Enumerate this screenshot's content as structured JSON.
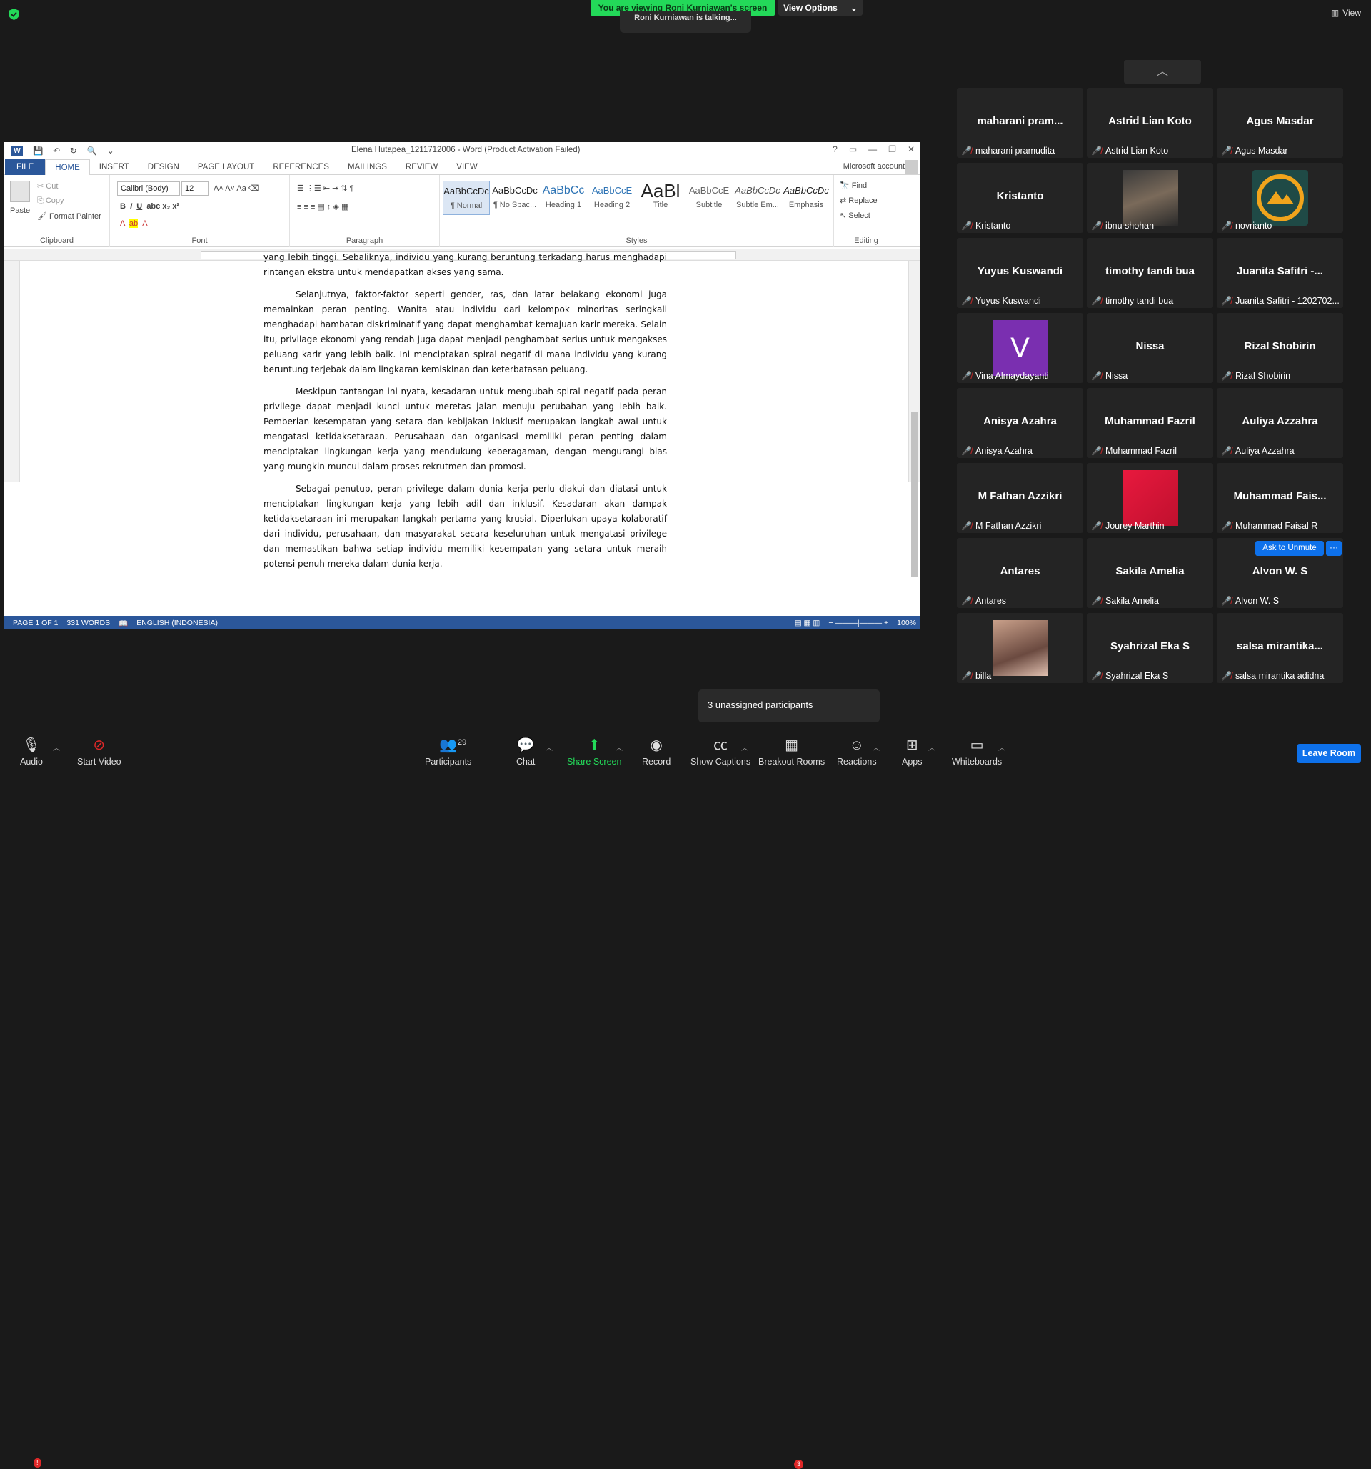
{
  "zoom": {
    "banner": "You are viewing Roni Kurniawan's screen",
    "view_options": "View Options",
    "talking": "Roni Kurniawan is talking...",
    "view_label": "View"
  },
  "word": {
    "title": "Elena Hutapea_1211712006 - Word (Product Activation Failed)",
    "tabs": [
      "FILE",
      "HOME",
      "INSERT",
      "DESIGN",
      "PAGE LAYOUT",
      "REFERENCES",
      "MAILINGS",
      "REVIEW",
      "VIEW"
    ],
    "account": "Microsoft account",
    "clipboard": {
      "paste": "Paste",
      "cut": "Cut",
      "copy": "Copy",
      "format_painter": "Format Painter",
      "label": "Clipboard"
    },
    "font": {
      "name": "Calibri (Body)",
      "size": "12",
      "label": "Font"
    },
    "paragraph_label": "Paragraph",
    "styles": [
      {
        "preview": "AaBbCcDc",
        "name": "¶ Normal"
      },
      {
        "preview": "AaBbCcDc",
        "name": "¶ No Spac..."
      },
      {
        "preview": "AaBbCc",
        "name": "Heading 1"
      },
      {
        "preview": "AaBbCcE",
        "name": "Heading 2"
      },
      {
        "preview": "AaBl",
        "name": "Title"
      },
      {
        "preview": "AaBbCcE",
        "name": "Subtitle"
      },
      {
        "preview": "AaBbCcDc",
        "name": "Subtle Em..."
      },
      {
        "preview": "AaBbCcDc",
        "name": "Emphasis"
      }
    ],
    "styles_label": "Styles",
    "editing": {
      "find": "Find",
      "replace": "Replace",
      "select": "Select",
      "label": "Editing"
    },
    "paragraphs": [
      "yang lebih tinggi. Sebaliknya, individu yang kurang beruntung terkadang harus menghadapi rintangan ekstra untuk mendapatkan akses yang sama.",
      "Selanjutnya, faktor-faktor seperti gender, ras, dan latar belakang ekonomi juga memainkan peran penting. Wanita atau individu dari kelompok minoritas seringkali menghadapi hambatan diskriminatif yang dapat menghambat kemajuan karir mereka. Selain itu, privilage ekonomi yang rendah juga dapat menjadi penghambat serius untuk mengakses peluang karir yang lebih baik. Ini menciptakan spiral negatif di mana individu yang kurang beruntung terjebak dalam lingkaran kemiskinan dan keterbatasan peluang.",
      "Meskipun tantangan ini nyata, kesadaran untuk mengubah spiral negatif pada peran privilege dapat menjadi kunci untuk meretas jalan menuju perubahan yang lebih baik. Pemberian kesempatan yang setara dan kebijakan inklusif merupakan langkah awal untuk mengatasi ketidaksetaraan. Perusahaan dan organisasi memiliki peran penting dalam menciptakan lingkungan kerja yang mendukung keberagaman, dengan mengurangi bias yang mungkin muncul dalam proses rekrutmen dan promosi.",
      "Sebagai penutup, peran privilege dalam dunia kerja perlu diakui dan diatasi untuk menciptakan lingkungan kerja yang lebih adil dan inklusif. Kesadaran akan dampak ketidaksetaraan ini merupakan langkah pertama yang krusial. Diperlukan upaya kolaboratif dari individu, perusahaan, dan masyarakat secara keseluruhan untuk mengatasi privilege dan memastikan bahwa setiap individu memiliki kesempatan yang setara untuk meraih potensi penuh mereka dalam dunia kerja."
    ],
    "status": {
      "page": "PAGE 1 OF 1",
      "words": "331 WORDS",
      "lang": "ENGLISH (INDONESIA)",
      "zoom": "100%"
    }
  },
  "participants": [
    {
      "big": "maharani  pram...",
      "small": "maharani pramudita",
      "video": "none"
    },
    {
      "big": "Astrid Lian Koto",
      "small": "Astrid Lian Koto",
      "video": "none"
    },
    {
      "big": "Agus Masdar",
      "small": "Agus Masdar",
      "video": "none"
    },
    {
      "big": "Kristanto",
      "small": "Kristanto",
      "video": "none"
    },
    {
      "big": "",
      "small": "ibnu shohan",
      "video": "photo"
    },
    {
      "big": "",
      "small": "novrianto",
      "video": "logo"
    },
    {
      "big": "Yuyus Kuswandi",
      "small": "Yuyus Kuswandi",
      "video": "none"
    },
    {
      "big": "timothy tandi bua",
      "small": "timothy tandi bua",
      "video": "none"
    },
    {
      "big": "Juanita Safitri -...",
      "small": "Juanita Safitri - 1202702...",
      "video": "none"
    },
    {
      "big": "",
      "small": "Vina Almaydayanti",
      "video": "avatar-v"
    },
    {
      "big": "Nissa",
      "small": "Nissa",
      "video": "none"
    },
    {
      "big": "Rizal Shobirin",
      "small": "Rizal Shobirin",
      "video": "none"
    },
    {
      "big": "Anisya Azahra",
      "small": "Anisya Azahra",
      "video": "none"
    },
    {
      "big": "Muhammad Fazril",
      "small": "Muhammad Fazril",
      "video": "none"
    },
    {
      "big": "Auliya Azzahra",
      "small": "Auliya Azzahra",
      "video": "none"
    },
    {
      "big": "M Fathan Azzikri",
      "small": "M Fathan Azzikri",
      "video": "none"
    },
    {
      "big": "",
      "small": "Jourey Marthin",
      "video": "red"
    },
    {
      "big": "Muhammad  Fais...",
      "small": "Muhammad Faisal R",
      "video": "none"
    },
    {
      "big": "Antares",
      "small": "Antares",
      "video": "none"
    },
    {
      "big": "Sakila Amelia",
      "small": "Sakila Amelia",
      "video": "none"
    },
    {
      "big": "Alvon W. S",
      "small": "Alvon W. S",
      "video": "none"
    },
    {
      "big": "",
      "small": "billa",
      "video": "photo2"
    },
    {
      "big": "Syahrizal Eka S",
      "small": "Syahrizal Eka S",
      "video": "none"
    },
    {
      "big": "salsa  mirantika...",
      "small": "salsa mirantika adidna",
      "video": "none"
    }
  ],
  "avatar_letter": "V",
  "ask_unmute": "Ask to Unmute",
  "more": "···",
  "unassigned": "3 unassigned participants",
  "toolbar": {
    "audio": "Audio",
    "audio_badge": "!",
    "video": "Start Video",
    "participants": "Participants",
    "participants_count": "29",
    "chat": "Chat",
    "share": "Share Screen",
    "record": "Record",
    "captions": "Show Captions",
    "breakout": "Breakout Rooms",
    "breakout_badge": "3",
    "reactions": "Reactions",
    "apps": "Apps",
    "whiteboards": "Whiteboards",
    "leave": "Leave Room"
  }
}
